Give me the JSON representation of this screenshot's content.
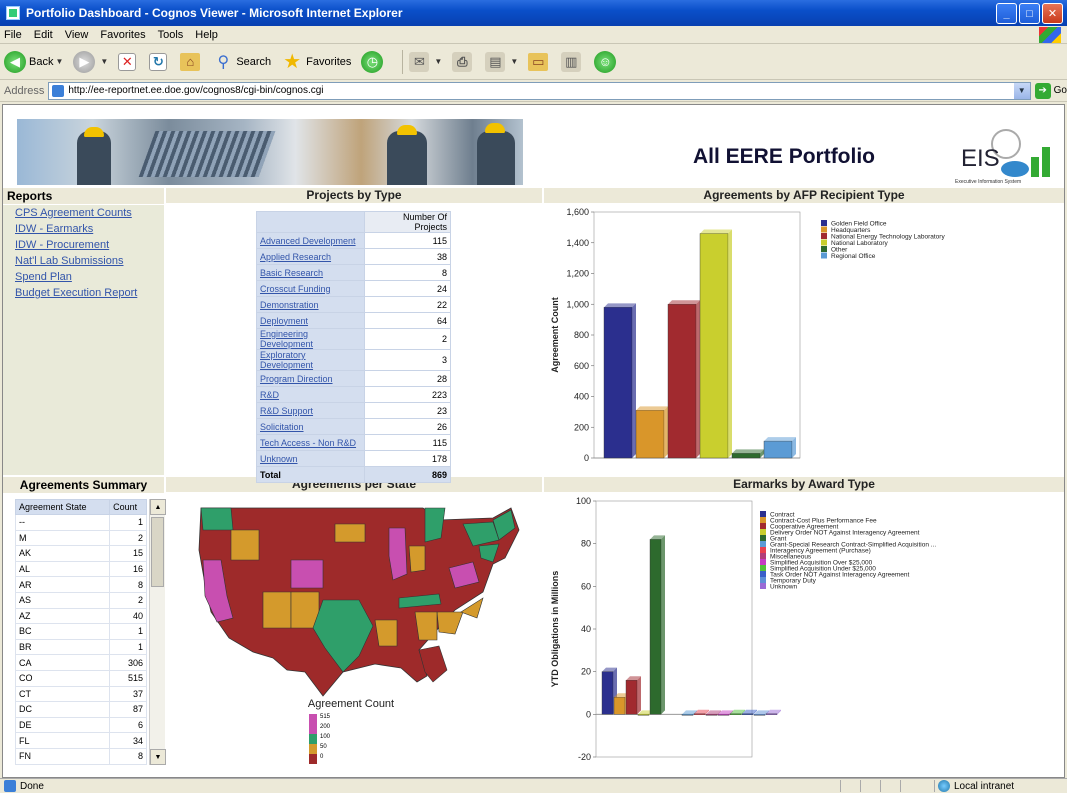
{
  "window": {
    "title": "Portfolio Dashboard - Cognos Viewer - Microsoft Internet Explorer",
    "buttons": [
      "_",
      "□",
      "✕"
    ]
  },
  "menu": [
    "File",
    "Edit",
    "View",
    "Favorites",
    "Tools",
    "Help"
  ],
  "toolbar": {
    "back": "Back",
    "search": "Search",
    "favorites": "Favorites"
  },
  "address": {
    "label": "Address",
    "url": "http://ee-reportnet.ee.doe.gov/cognos8/cgi-bin/cognos.cgi",
    "go": "Go"
  },
  "banner": {
    "title": "All EERE  Portfolio",
    "logo_text": "EIS",
    "logo_sub": "Executive Information System"
  },
  "reports": {
    "heading": "Reports",
    "links": [
      "CPS Agreement Counts",
      "IDW - Earmarks",
      "IDW - Procurement",
      "Nat'l Lab Submissions",
      "Spend Plan",
      "Budget Execution Report"
    ]
  },
  "projects_by_type": {
    "heading": "Projects by Type",
    "col_header": "Number Of Projects",
    "rows": [
      {
        "type": "Advanced Development",
        "count": "115"
      },
      {
        "type": "Applied Research",
        "count": "38"
      },
      {
        "type": "Basic Research",
        "count": "8"
      },
      {
        "type": "Crosscut Funding",
        "count": "24"
      },
      {
        "type": "Demonstration",
        "count": "22"
      },
      {
        "type": "Deployment",
        "count": "64"
      },
      {
        "type": "Engineering Development",
        "count": "2"
      },
      {
        "type": "Exploratory Development",
        "count": "3"
      },
      {
        "type": "Program Direction",
        "count": "28"
      },
      {
        "type": "R&D",
        "count": "223"
      },
      {
        "type": "R&D Support",
        "count": "23"
      },
      {
        "type": "Solicitation",
        "count": "26"
      },
      {
        "type": "Tech Access - Non R&D",
        "count": "115"
      },
      {
        "type": "Unknown",
        "count": "178"
      }
    ],
    "total_label": "Total",
    "total": "869"
  },
  "agreements_summary": {
    "heading": "Agreements Summary",
    "col_state": "Agreement State",
    "col_count": "Count",
    "rows": [
      {
        "state": "--",
        "count": "1"
      },
      {
        "state": "M",
        "count": "2"
      },
      {
        "state": "AK",
        "count": "15"
      },
      {
        "state": "AL",
        "count": "16"
      },
      {
        "state": "AR",
        "count": "8"
      },
      {
        "state": "AS",
        "count": "2"
      },
      {
        "state": "AZ",
        "count": "40"
      },
      {
        "state": "BC",
        "count": "1"
      },
      {
        "state": "BR",
        "count": "1"
      },
      {
        "state": "CA",
        "count": "306"
      },
      {
        "state": "CO",
        "count": "515"
      },
      {
        "state": "CT",
        "count": "37"
      },
      {
        "state": "DC",
        "count": "87"
      },
      {
        "state": "DE",
        "count": "6"
      },
      {
        "state": "FL",
        "count": "34"
      },
      {
        "state": "FN",
        "count": "8"
      }
    ]
  },
  "agreements_per_state": {
    "heading": "Agreements per State",
    "legend_title": "Agreement Count",
    "legend": [
      {
        "label": "515",
        "color": "#c84fb0"
      },
      {
        "label": "200",
        "color": "#c84fb0"
      },
      {
        "label": "100",
        "color": "#2f9f6a"
      },
      {
        "label": "50",
        "color": "#d49a2c"
      },
      {
        "label": "0",
        "color": "#9e2a2a"
      }
    ]
  },
  "statusbar": {
    "left": "Done",
    "zone": "Local intranet"
  },
  "chart_data": [
    {
      "type": "bar",
      "title": "Agreements by AFP Recipient Type",
      "ylabel": "Agreement Count",
      "ylim": [
        0,
        1600
      ],
      "yticks": [
        "0",
        "200",
        "400",
        "600",
        "800",
        "1,000",
        "1,200",
        "1,400",
        "1,600"
      ],
      "categories": [
        "Golden Field Office",
        "Headquarters",
        "National Energy Technology Laboratory",
        "National Laboratory",
        "Other",
        "Regional Office"
      ],
      "values": [
        980,
        310,
        1000,
        1460,
        30,
        110
      ],
      "colors": [
        "#2b2f8e",
        "#d9962a",
        "#a12a2f",
        "#c9cf2e",
        "#2d6a2d",
        "#5b9bd5"
      ],
      "legend_position": "top-right"
    },
    {
      "type": "bar",
      "title": "Earmarks by Award Type",
      "ylabel": "YTD Obligations in Millions",
      "ylim": [
        -20,
        100
      ],
      "yticks": [
        "-20",
        "0",
        "20",
        "40",
        "60",
        "80",
        "100"
      ],
      "categories": [
        "Contract",
        "Contract-Cost Plus Performance Fee",
        "Cooperative Agreement",
        "Delivery Order NOT Against Interagency Agreement",
        "Grant",
        "Grant-Special Research Contract-Simplified Acquisition ...",
        "Interagency Agreement (Purchase)",
        "Miscellaneous",
        "Simplified Acquisition Over $25,000",
        "Simplified Acquisition Under $25,000",
        "Task Order NOT Against Interagency Agreement",
        "Temporary Duty",
        "Unknown"
      ],
      "values": [
        20,
        8,
        16,
        0,
        82,
        0,
        0.3,
        0,
        0,
        0.3,
        0.3,
        0,
        0.3
      ],
      "colors": [
        "#2b2f8e",
        "#d9962a",
        "#a12a2f",
        "#c9cf2e",
        "#2d6a2d",
        "#5b9bd5",
        "#e8414f",
        "#b23e7a",
        "#c73cc4",
        "#52c23a",
        "#3a5fc9",
        "#5e8fd6",
        "#9a6ad6"
      ],
      "legend_position": "top-right"
    }
  ]
}
